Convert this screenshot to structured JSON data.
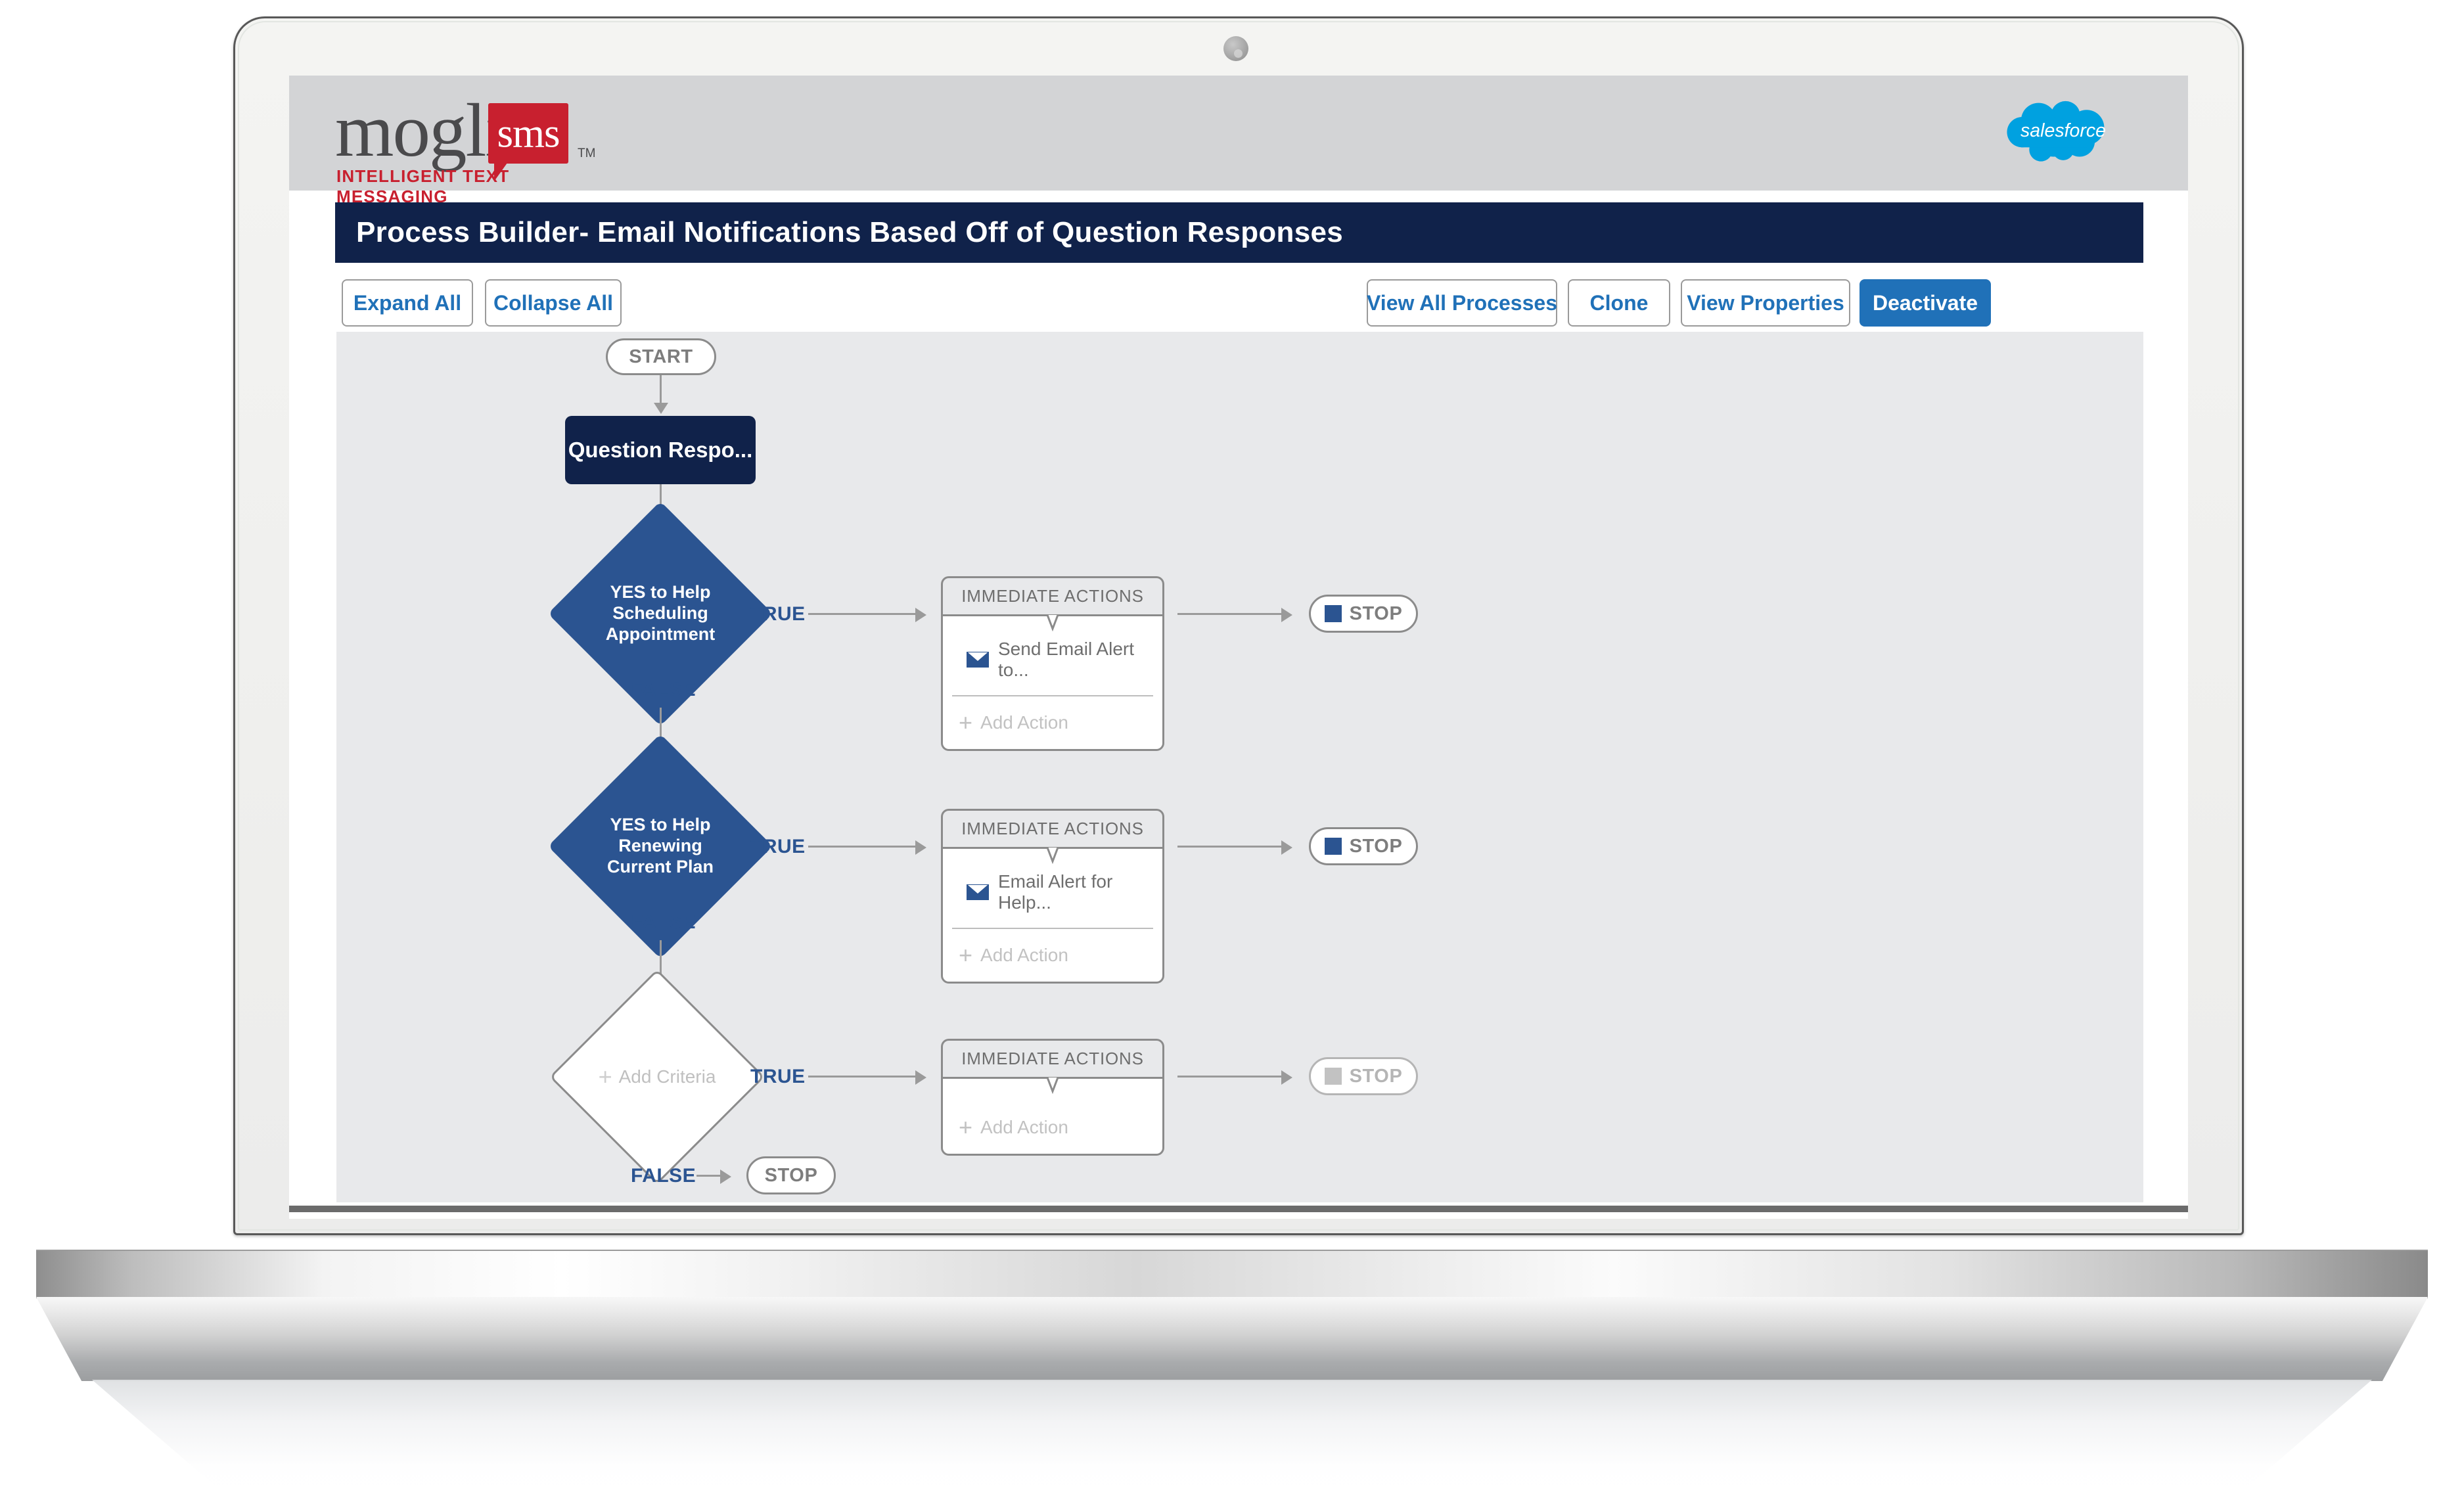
{
  "brand": {
    "mogli_word": "mogli",
    "mogli_bubble": "sms",
    "mogli_tm": "TM",
    "mogli_tagline": "INTELLIGENT TEXT MESSAGING",
    "salesforce_label": "salesforce",
    "colors": {
      "mogli_red": "#c8202f",
      "salesforce_blue": "#00a1e0",
      "navy": "#10224a",
      "accent_blue": "#2071b8",
      "node_blue": "#2b5491"
    }
  },
  "page": {
    "title": "Process Builder- Email Notifications Based Off of Question Responses"
  },
  "toolbar": {
    "expand_all": "Expand All",
    "collapse_all": "Collapse  All",
    "view_all_processes": "View  All Processes",
    "clone": "Clone",
    "view_properties": "View Properties",
    "deactivate": "Deactivate"
  },
  "flow": {
    "start_label": "START",
    "object_node": "Question Respo...",
    "true_label": "TRUE",
    "false_label": "FALSE",
    "stop_label": "STOP",
    "immediate_actions_label": "IMMEDIATE ACTIONS",
    "add_action_label": "Add Action",
    "add_criteria_label": "Add Criteria",
    "plus_glyph": "+",
    "criteria": [
      {
        "name": "YES to Help Scheduling Appointment",
        "type": "filled",
        "action": "Send Email Alert to...",
        "has_action": true,
        "stop_enabled": true
      },
      {
        "name": "YES to Help Renewing Current Plan",
        "type": "filled",
        "action": "Email Alert for Help...",
        "has_action": true,
        "stop_enabled": true
      },
      {
        "name": "Add Criteria",
        "type": "empty",
        "action": "",
        "has_action": false,
        "stop_enabled": false
      }
    ],
    "final_false_stop": "STOP"
  }
}
